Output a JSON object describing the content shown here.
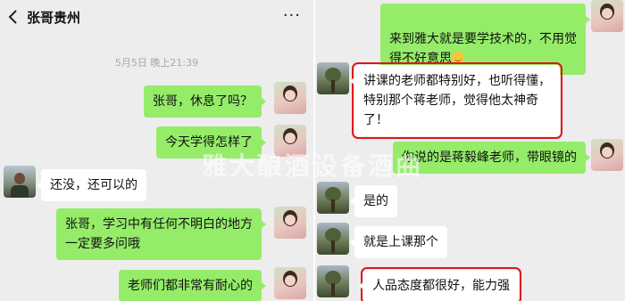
{
  "left": {
    "header": {
      "title": "张哥贵州",
      "more": "···"
    },
    "timestamp": "5月5日 晚上21:39",
    "messages": [
      {
        "text": "张哥，休息了吗？"
      },
      {
        "text": "今天学得怎样了"
      },
      {
        "text": "还没，还可以的"
      },
      {
        "text": "张哥，学习中有任何不明白的地方\n一定要多问哦"
      },
      {
        "text": "老师们都非常有耐心的"
      }
    ]
  },
  "right": {
    "messages": [
      {
        "text": "来到雅大就是要学技术的，不用觉\n得不好意思"
      },
      {
        "text": "讲课的老师都特别好，也听得懂，\n特别那个蒋老师，觉得他太神奇\n了！"
      },
      {
        "text": "你说的是蒋毅峰老师，带眼镜的"
      },
      {
        "text": "是的"
      },
      {
        "text": "就是上课那个"
      },
      {
        "text": "人品态度都很好，能力强"
      }
    ]
  },
  "watermark": "雅大酿酒设备酒曲",
  "colors": {
    "sent_bubble": "#95ec69",
    "received_bubble": "#ffffff",
    "chat_background": "#ededed",
    "highlight_box": "#e0141e"
  },
  "icons": {
    "back": "chevron-left-icon",
    "emoji": "smile-emoji-icon"
  }
}
